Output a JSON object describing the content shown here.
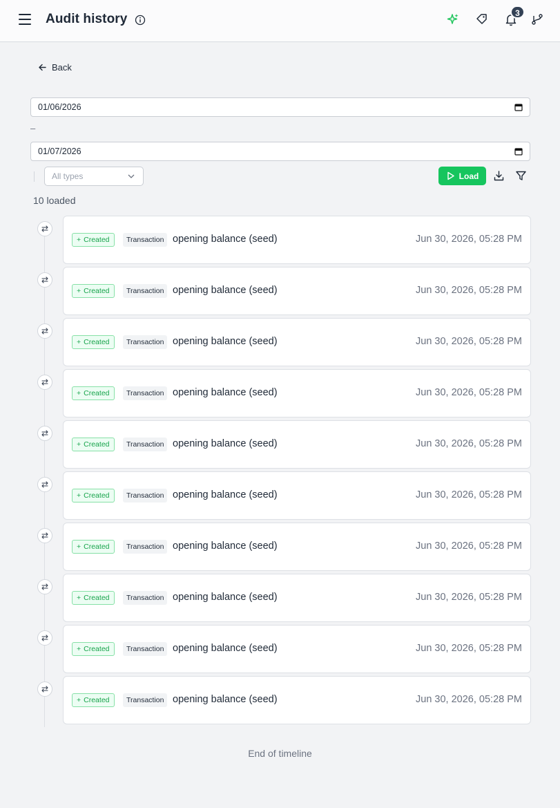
{
  "header": {
    "title": "Audit history",
    "notification_count": "3",
    "icons": [
      "menu-icon",
      "info-icon",
      "sparkle-icon",
      "tag-icon",
      "bell-icon",
      "git-branch-icon"
    ],
    "accent_color": "#22c55e"
  },
  "back_label": "Back",
  "filters": {
    "date_from": "01/06/2026",
    "date_separator": "–",
    "date_to": "01/07/2026",
    "type_placeholder": "All types",
    "load_label": "Load"
  },
  "loaded_text": "10 loaded",
  "entries": [
    {
      "action": "Created",
      "type": "Transaction",
      "description": "opening balance (seed)",
      "time": "Jun 30, 2026, 05:28 PM"
    },
    {
      "action": "Created",
      "type": "Transaction",
      "description": "opening balance (seed)",
      "time": "Jun 30, 2026, 05:28 PM"
    },
    {
      "action": "Created",
      "type": "Transaction",
      "description": "opening balance (seed)",
      "time": "Jun 30, 2026, 05:28 PM"
    },
    {
      "action": "Created",
      "type": "Transaction",
      "description": "opening balance (seed)",
      "time": "Jun 30, 2026, 05:28 PM"
    },
    {
      "action": "Created",
      "type": "Transaction",
      "description": "opening balance (seed)",
      "time": "Jun 30, 2026, 05:28 PM"
    },
    {
      "action": "Created",
      "type": "Transaction",
      "description": "opening balance (seed)",
      "time": "Jun 30, 2026, 05:28 PM"
    },
    {
      "action": "Created",
      "type": "Transaction",
      "description": "opening balance (seed)",
      "time": "Jun 30, 2026, 05:28 PM"
    },
    {
      "action": "Created",
      "type": "Transaction",
      "description": "opening balance (seed)",
      "time": "Jun 30, 2026, 05:28 PM"
    },
    {
      "action": "Created",
      "type": "Transaction",
      "description": "opening balance (seed)",
      "time": "Jun 30, 2026, 05:28 PM"
    },
    {
      "action": "Created",
      "type": "Transaction",
      "description": "opening balance (seed)",
      "time": "Jun 30, 2026, 05:28 PM"
    }
  ],
  "end_text": "End of timeline"
}
